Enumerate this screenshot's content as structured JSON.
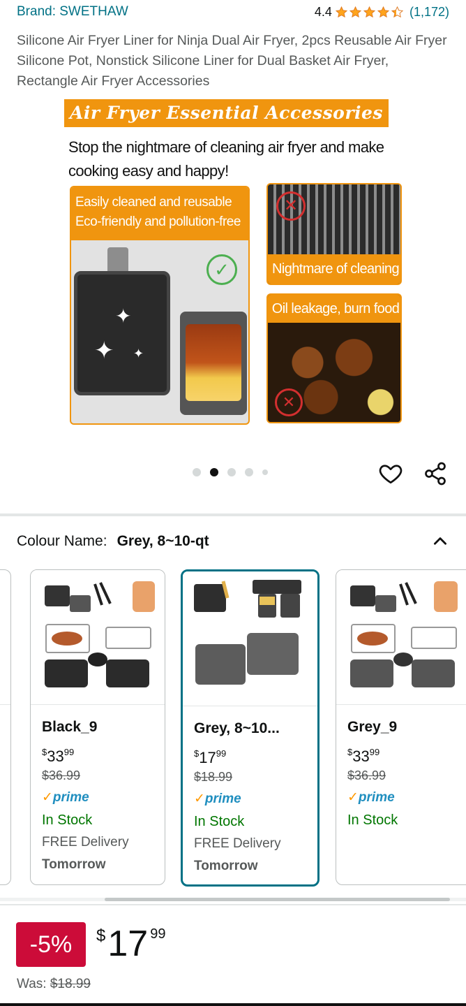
{
  "brand": {
    "label": "Brand: SWETHAW"
  },
  "rating": {
    "value": "4.4",
    "stars": 4.4,
    "count": "(1,172)"
  },
  "product_title": "Silicone Air Fryer Liner for Ninja Dual Air Fryer, 2pcs Reusable Air Fryer Silicone Pot, Nonstick Silicone Liner for Dual Basket Air Fryer, Rectangle Air Fryer Accessories",
  "hero": {
    "banner": "Air Fryer Essential Accessories",
    "subtitle": "Stop the nightmare of cleaning air fryer and make cooking easy and happy!",
    "left_label_line1": "Easily cleaned and reusable",
    "left_label_line2": "Eco-friendly and pollution-free",
    "right_top_label": "Nightmare of cleaning",
    "right_bottom_label": "Oil leakage, burn food"
  },
  "carousel": {
    "count": 5,
    "active_index": 1
  },
  "actions": {
    "wishlist_icon": "heart-icon",
    "share_icon": "share-icon"
  },
  "variation": {
    "label": "Colour Name:",
    "selected": "Grey, 8~10-qt",
    "options": [
      {
        "name": "Black_9",
        "currency": "$",
        "whole": "33",
        "fraction": "99",
        "was": "$36.99",
        "prime_check": "✓",
        "prime": "prime",
        "stock": "In Stock",
        "delivery": "FREE Delivery",
        "delivery_day": "Tomorrow"
      },
      {
        "name": "Grey, 8~10...",
        "currency": "$",
        "whole": "17",
        "fraction": "99",
        "was": "$18.99",
        "prime_check": "✓",
        "prime": "prime",
        "stock": "In Stock",
        "delivery": "FREE Delivery",
        "delivery_day": "Tomorrow"
      },
      {
        "name": "Grey_9",
        "currency": "$",
        "whole": "33",
        "fraction": "99",
        "was": "$36.99",
        "prime_check": "✓",
        "prime": "prime",
        "stock": "In Stock"
      }
    ]
  },
  "price": {
    "discount": "-5%",
    "currency": "$",
    "whole": "17",
    "fraction": "99",
    "was_label": "Was: ",
    "was_value": "$18.99"
  },
  "colors": {
    "link": "#007185",
    "deal_red": "#cc0c39",
    "stock_green": "#007600",
    "prime_blue": "#1f8ebf",
    "star_orange": "#ffa41c"
  }
}
